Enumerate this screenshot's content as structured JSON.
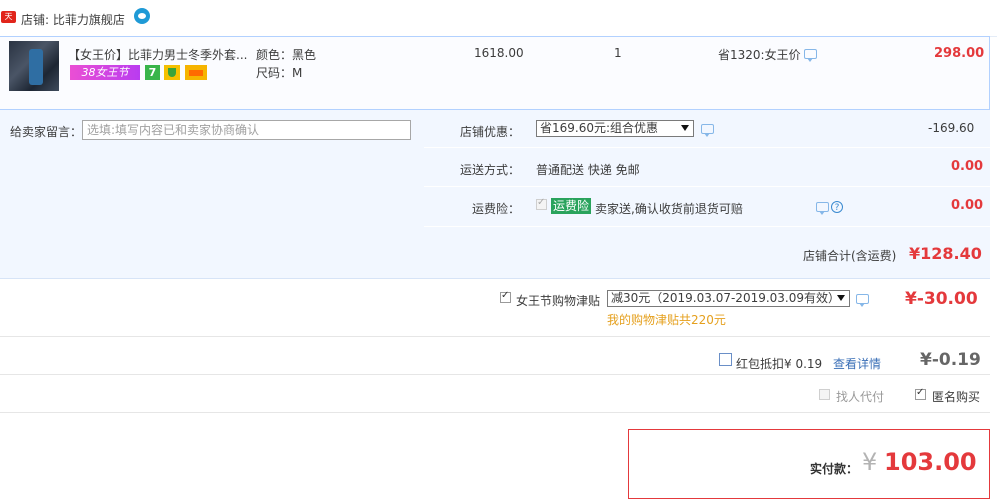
{
  "shop": {
    "tmall_badge": "天猫",
    "label": "店铺: 比菲力旗舰店"
  },
  "item": {
    "title": "【女王价】比菲力男士冬季外套...",
    "badges": {
      "festival": "38女王节",
      "seven_day": "7"
    },
    "attr_color": "颜色：黑色",
    "attr_size": "尺码：M",
    "original_price": "1618.00",
    "quantity": "1",
    "discount_note": "省1320:女王价",
    "price": "298.00"
  },
  "memo": {
    "label": "给卖家留言：",
    "placeholder": "选填:填写内容已和卖家协商确认"
  },
  "shop_discount": {
    "label": "店铺优惠：",
    "selected": "省169.60元:组合优惠",
    "value": "-169.60"
  },
  "shipping": {
    "label": "运送方式：",
    "method": "普通配送 快递 免邮",
    "value": "0.00"
  },
  "insurance": {
    "label": "运费险：",
    "tag": "运费险",
    "desc": "卖家送,确认收货前退货可赔",
    "value": "0.00"
  },
  "shop_total": {
    "label": "店铺合计(含运费)",
    "value": "¥128.40"
  },
  "allowance": {
    "label": "女王节购物津贴",
    "selected": "减30元（2019.03.07-2019.03.09有效）",
    "note": "我的购物津贴共220元",
    "value": "¥-30.00"
  },
  "red_packet": {
    "label": "红包抵扣¥ 0.19",
    "link": "查看详情",
    "value": "¥-0.19"
  },
  "options": {
    "proxy_pay": "找人代付",
    "anonymous": "匿名购买"
  },
  "payment": {
    "label": "实付款：",
    "currency": "¥",
    "value": "103.00"
  },
  "colors": {
    "accent_red": "#e4393c",
    "panel_blue": "#f2f7ff",
    "border_blue": "#b2d1ff",
    "note_orange": "#e5a01e",
    "tag_green": "#2aa35c"
  }
}
